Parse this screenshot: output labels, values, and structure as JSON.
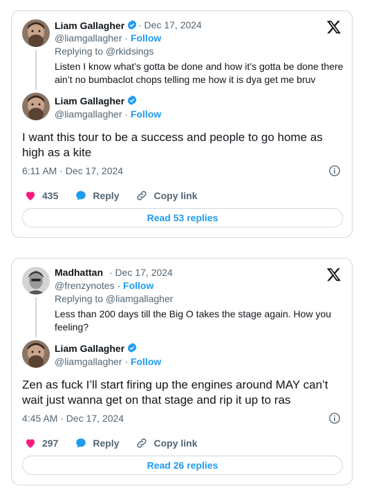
{
  "tweets": [
    {
      "reply_to": {
        "name": "Liam Gallagher",
        "date": "· Dec 17, 2024",
        "handle": "@liamgallagher ·",
        "follow": "Follow",
        "replying": "Replying to @rkidsings",
        "text_line1": "Listen I know what’s gotta be done and how it’s gotta be done there",
        "text_line2": "ain’t no bumbaclot chops telling me how it is dya get me bruv"
      },
      "main": {
        "name": "Liam Gallagher",
        "handle": "@liamgallagher ·",
        "follow": "Follow",
        "text_line1": "I want this tour to be a success and people to go home as",
        "text_line2": "high as a kite",
        "timestamp": "6:11 AM · Dec 17, 2024"
      },
      "likes": "435",
      "reply_label": "Reply",
      "copy_label": "Copy link",
      "read_replies": "Read 53 replies"
    },
    {
      "reply_to": {
        "name": "Madhattan",
        "date": "· Dec 17, 2024",
        "handle": "@frenzynotes ·",
        "follow": "Follow",
        "replying": "Replying to @liamgallagher",
        "text_line1": "Less than 200 days till the Big O takes the stage again. How you",
        "text_line2": "feeling?"
      },
      "main": {
        "name": "Liam Gallagher",
        "handle": "@liamgallagher ·",
        "follow": "Follow",
        "text_line1": "Zen as fuck I’ll start firing up the engines around MAY can’t",
        "text_line2": "wait just wanna get on that stage and rip it up to ras",
        "timestamp": "4:45 AM · Dec 17, 2024"
      },
      "likes": "297",
      "reply_label": "Reply",
      "copy_label": "Copy link",
      "read_replies": "Read 26 replies"
    }
  ],
  "colors": {
    "accent": "#1d9bf0",
    "like": "#f91880",
    "muted": "#536471",
    "border": "#cfd9de"
  }
}
